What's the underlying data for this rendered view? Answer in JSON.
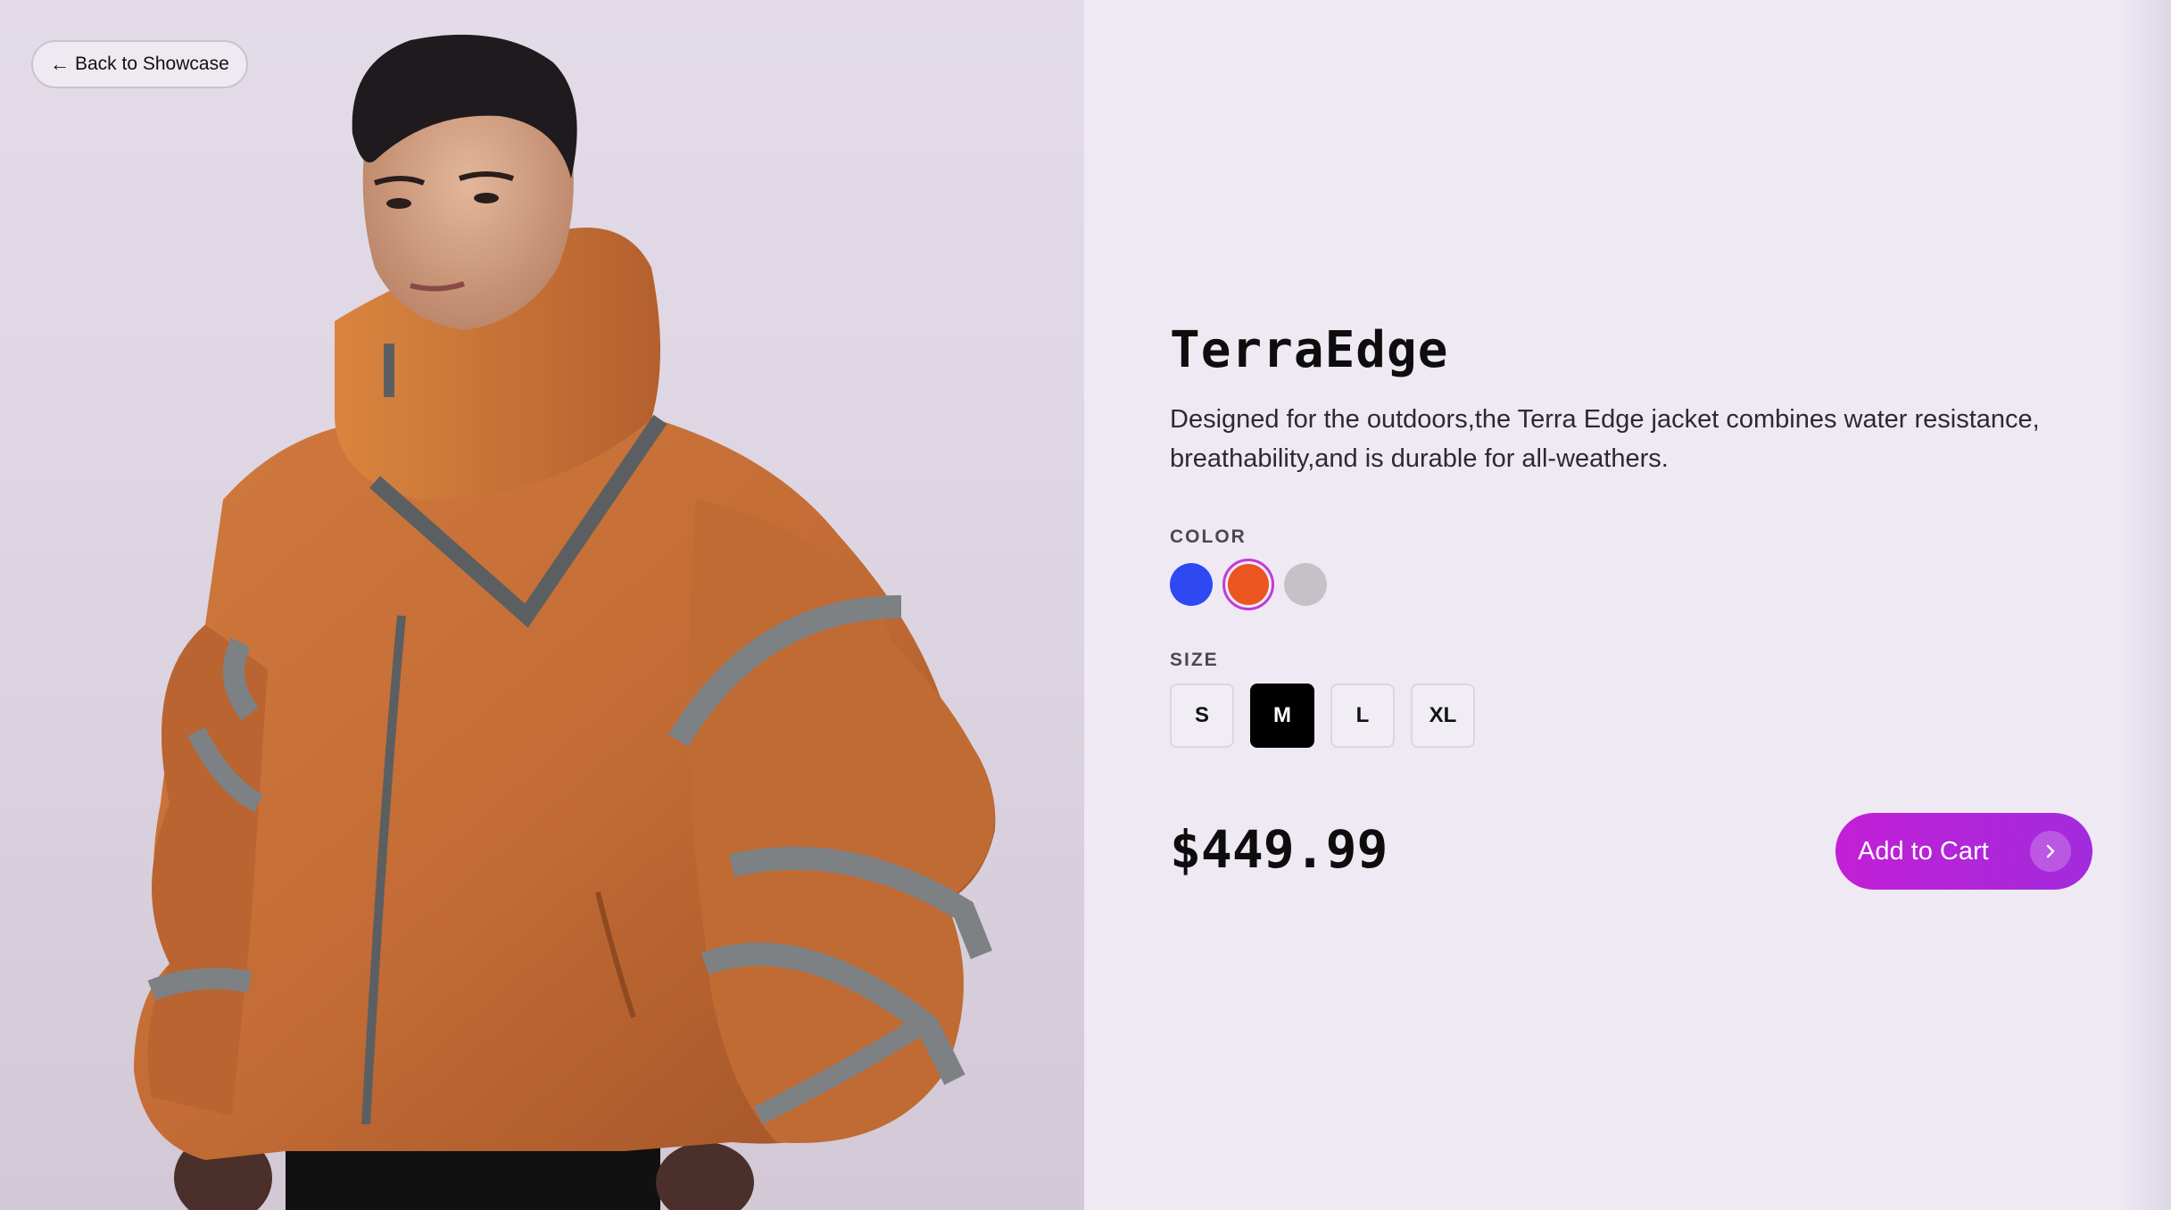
{
  "nav": {
    "back_label": "Back to Showcase"
  },
  "product": {
    "name": "TerraEdge",
    "description": "Designed for the outdoors,the Terra Edge jacket combines water resistance, breathability,and is durable for all-weathers.",
    "price": "$449.99"
  },
  "color": {
    "label": "COLOR",
    "options": [
      {
        "name": "blue",
        "hex": "#2e48f2",
        "selected": false
      },
      {
        "name": "orange",
        "hex": "#ea5520",
        "selected": true
      },
      {
        "name": "grey",
        "hex": "#c4c2c6",
        "selected": false
      }
    ],
    "selected_ring": "#c43ad6"
  },
  "size": {
    "label": "SIZE",
    "options": [
      "S",
      "M",
      "L",
      "XL"
    ],
    "selected": "M"
  },
  "cart": {
    "label": "Add to Cart",
    "gradient_start": "#c21fd6",
    "gradient_end": "#a22bdc"
  },
  "hero": {
    "jacket_color": "#c46f38",
    "background": "#e0d9e5"
  }
}
